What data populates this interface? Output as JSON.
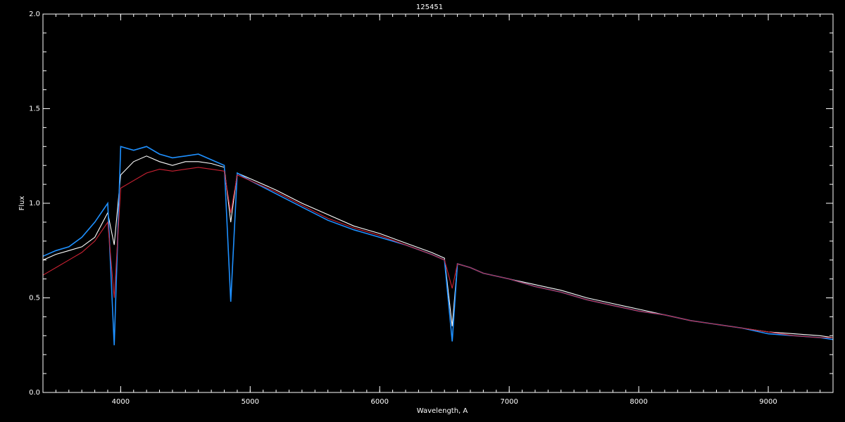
{
  "chart_data": {
    "type": "line",
    "title": "125451",
    "xlabel": "Wavelength, A",
    "ylabel": "Flux",
    "xlim": [
      3400,
      9500
    ],
    "ylim": [
      0.0,
      2.0
    ],
    "x_ticks": [
      4000,
      5000,
      6000,
      7000,
      8000,
      9000
    ],
    "x_tick_labels": [
      "4000",
      "5000",
      "6000",
      "7000",
      "8000",
      "9000"
    ],
    "y_ticks": [
      0.0,
      0.5,
      1.0,
      1.5,
      2.0
    ],
    "y_tick_labels": [
      "0.0",
      "0.5",
      "1.0",
      "1.5",
      "2.0"
    ],
    "grid": false,
    "background": "#000000",
    "series": [
      {
        "color": "#ffffff",
        "x": [
          3400,
          3500,
          3600,
          3700,
          3800,
          3900,
          3950,
          4000,
          4100,
          4200,
          4300,
          4400,
          4500,
          4600,
          4700,
          4800,
          4850,
          4900,
          5000,
          5200,
          5400,
          5600,
          5800,
          6000,
          6200,
          6400,
          6500,
          6560,
          6600,
          6700,
          6800,
          7000,
          7200,
          7400,
          7600,
          7800,
          8000,
          8200,
          8400,
          8600,
          8800,
          9000,
          9200,
          9400,
          9500
        ],
        "y": [
          0.7,
          0.73,
          0.75,
          0.77,
          0.82,
          0.95,
          0.78,
          1.15,
          1.22,
          1.25,
          1.22,
          1.2,
          1.22,
          1.22,
          1.21,
          1.19,
          0.9,
          1.16,
          1.13,
          1.07,
          1.0,
          0.94,
          0.88,
          0.84,
          0.79,
          0.74,
          0.71,
          0.35,
          0.68,
          0.66,
          0.63,
          0.6,
          0.57,
          0.54,
          0.5,
          0.47,
          0.44,
          0.41,
          0.38,
          0.36,
          0.34,
          0.32,
          0.31,
          0.3,
          0.29
        ]
      },
      {
        "color": "#1e90ff",
        "x": [
          3400,
          3500,
          3600,
          3700,
          3800,
          3900,
          3950,
          4000,
          4100,
          4200,
          4300,
          4400,
          4500,
          4600,
          4700,
          4800,
          4850,
          4900,
          5000,
          5200,
          5400,
          5600,
          5800,
          6000,
          6200,
          6400,
          6500,
          6560,
          6600,
          6700,
          6800,
          7000,
          7200,
          7400,
          7600,
          7800,
          8000,
          8200,
          8400,
          8600,
          8800,
          9000,
          9200,
          9400,
          9500
        ],
        "y": [
          0.72,
          0.75,
          0.77,
          0.82,
          0.9,
          1.0,
          0.25,
          1.3,
          1.28,
          1.3,
          1.26,
          1.24,
          1.25,
          1.26,
          1.23,
          1.2,
          0.48,
          1.16,
          1.12,
          1.05,
          0.98,
          0.91,
          0.86,
          0.82,
          0.78,
          0.73,
          0.7,
          0.27,
          0.68,
          0.66,
          0.63,
          0.6,
          0.56,
          0.53,
          0.49,
          0.46,
          0.43,
          0.41,
          0.38,
          0.36,
          0.34,
          0.31,
          0.3,
          0.29,
          0.28
        ]
      },
      {
        "color": "#cc2233",
        "x": [
          3400,
          3500,
          3600,
          3700,
          3800,
          3900,
          3950,
          4000,
          4100,
          4200,
          4300,
          4400,
          4500,
          4600,
          4700,
          4800,
          4850,
          4900,
          5000,
          5200,
          5400,
          5600,
          5800,
          6000,
          6200,
          6400,
          6500,
          6560,
          6600,
          6700,
          6800,
          7000,
          7200,
          7400,
          7600,
          7800,
          8000,
          8200,
          8400,
          8600,
          8800,
          9000,
          9200,
          9400,
          9500
        ],
        "y": [
          0.62,
          0.66,
          0.7,
          0.74,
          0.8,
          0.9,
          0.5,
          1.08,
          1.12,
          1.16,
          1.18,
          1.17,
          1.18,
          1.19,
          1.18,
          1.17,
          0.95,
          1.15,
          1.12,
          1.06,
          0.99,
          0.92,
          0.87,
          0.83,
          0.78,
          0.73,
          0.7,
          0.55,
          0.68,
          0.66,
          0.63,
          0.6,
          0.56,
          0.53,
          0.49,
          0.46,
          0.43,
          0.41,
          0.38,
          0.36,
          0.34,
          0.32,
          0.3,
          0.29,
          0.29
        ]
      }
    ]
  }
}
